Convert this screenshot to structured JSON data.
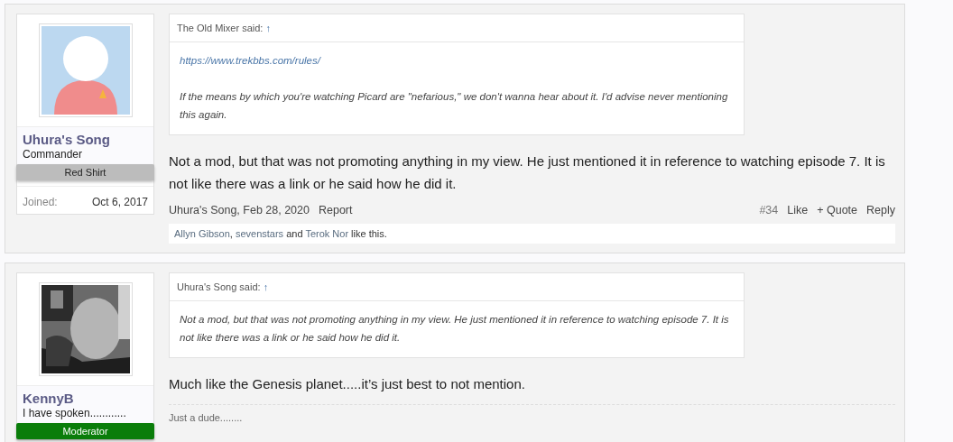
{
  "posts": [
    {
      "user": {
        "name": "Uhura's Song",
        "title": "Commander",
        "banner": {
          "label": "Red Shirt",
          "color": "#bcbcbc"
        },
        "avatar": {
          "kind": "default"
        },
        "joined": {
          "label": "Joined:",
          "value": "Oct 6, 2017"
        }
      },
      "quote": {
        "author": "The Old Mixer said:",
        "arrow": "↑",
        "lines": [
          {
            "kind": "link",
            "text": "https://www.trekbbs.com/rules/"
          },
          {
            "kind": "text",
            "text": "If the means by which you're watching Picard are \"nefarious,\" we don't wanna hear about it. I'd advise never mentioning this again."
          }
        ]
      },
      "message": "Not a mod, but that was not promoting anything in my view. He just mentioned it in reference to watching episode 7. It is not like there was a link or he said how he did it.",
      "meta": {
        "author_date": "Uhura's Song, Feb 28, 2020",
        "report": "Report",
        "number": "#34",
        "like": "Like",
        "quote": "+ Quote",
        "reply": "Reply"
      },
      "likes": [
        {
          "kind": "link",
          "text": "Allyn Gibson"
        },
        {
          "kind": "text",
          "text": ", "
        },
        {
          "kind": "link",
          "text": "sevenstars"
        },
        {
          "kind": "text",
          "text": " and "
        },
        {
          "kind": "link",
          "text": "Terok Nor"
        },
        {
          "kind": "text",
          "text": " like this."
        }
      ]
    },
    {
      "user": {
        "name": "KennyB",
        "title": "I have spoken............",
        "banner": {
          "label": "Moderator",
          "color": "#0a7d0a"
        }
      },
      "quote": {
        "author": "Uhura's Song said:",
        "arrow": "↑",
        "lines": [
          {
            "kind": "text",
            "text": "Not a mod, but that was not promoting anything in my view. He just mentioned it in reference to watching episode 7. It is not like there was a link or he said how he did it."
          }
        ]
      },
      "message": "Much like the Genesis planet.....it’s just best to not mention.",
      "signature": "Just a dude........"
    }
  ]
}
